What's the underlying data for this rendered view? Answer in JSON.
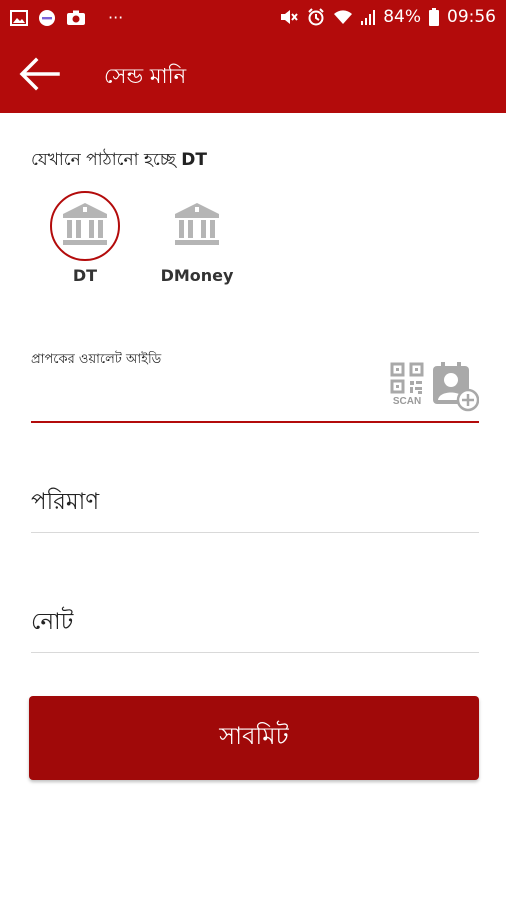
{
  "status_bar": {
    "battery": "84%",
    "time": "09:56",
    "overflow": "···"
  },
  "app_bar": {
    "title": "সেন্ড মানি"
  },
  "destination": {
    "prefix": "যেখানে পাঠানো হচ্ছে",
    "selected": "DT",
    "options": [
      {
        "label": "DT",
        "selected": true
      },
      {
        "label": "DMoney",
        "selected": false
      }
    ]
  },
  "wallet": {
    "label": "প্রাপকের ওয়ালেট আইডি",
    "value": "",
    "scan_label": "SCAN"
  },
  "amount": {
    "placeholder": "পরিমাণ"
  },
  "note": {
    "placeholder": "নোট"
  },
  "submit": {
    "label": "সাবমিট"
  },
  "colors": {
    "primary": "#b30b0b",
    "button": "#a00909",
    "icon_gray": "#a9a9a9"
  }
}
